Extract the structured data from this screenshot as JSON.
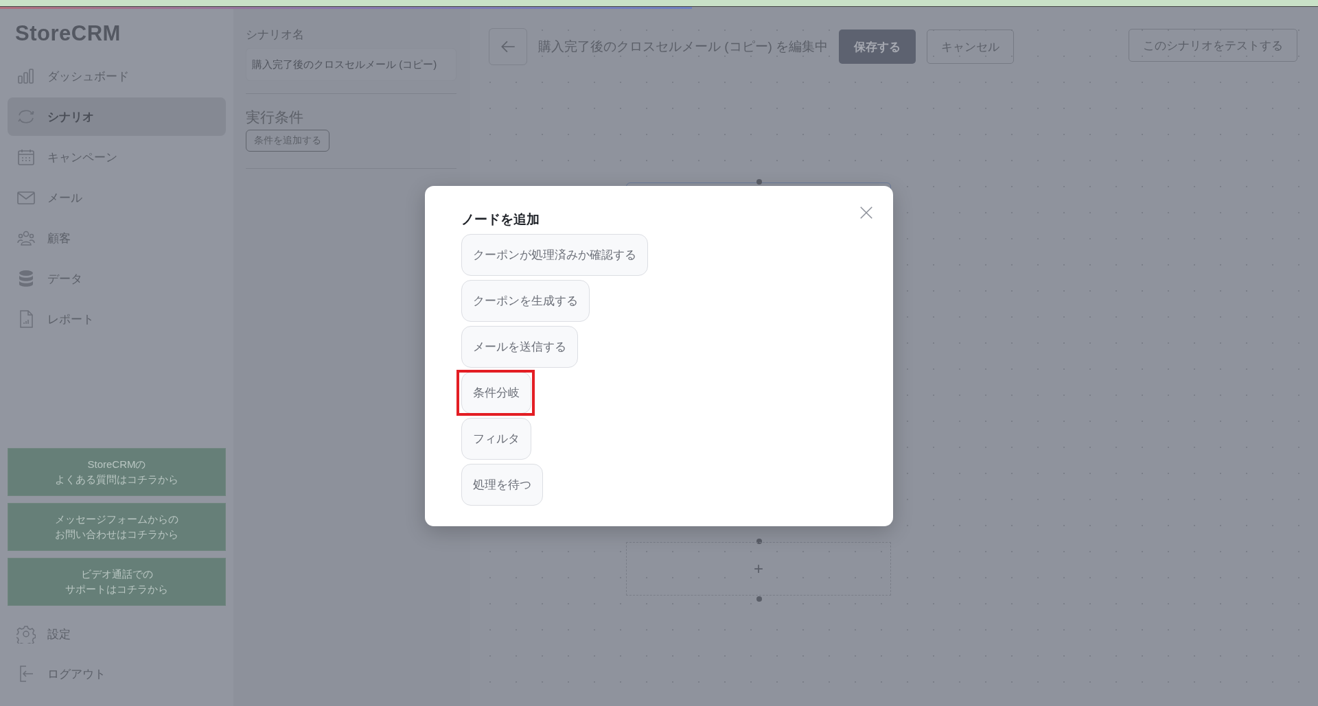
{
  "top_progress": {
    "level": 0.525
  },
  "sidebar": {
    "logo": "StoreCRM",
    "items": [
      {
        "label": "ダッシュボード",
        "selected": false
      },
      {
        "label": "シナリオ",
        "selected": true
      },
      {
        "label": "キャンペーン",
        "selected": false
      },
      {
        "label": "メール",
        "selected": false
      },
      {
        "label": "顧客",
        "selected": false
      },
      {
        "label": "データ",
        "selected": false
      },
      {
        "label": "レポート",
        "selected": false
      }
    ],
    "help_buttons": [
      {
        "lines": [
          "StoreCRMの",
          "よくある質問はコチラから"
        ]
      },
      {
        "lines": [
          "メッセージフォームからの",
          "お問い合わせはコチラから"
        ]
      },
      {
        "lines": [
          "ビデオ通話での",
          "サポートはコチラから"
        ]
      }
    ],
    "bottom_items": [
      {
        "label": "設定"
      },
      {
        "label": "ログアウト"
      }
    ]
  },
  "settings_panel": {
    "name_label": "シナリオ名",
    "name_value": "購入完了後のクロスセルメール (コピー)",
    "conditions_title": "実行条件",
    "add_condition": "条件を追加する"
  },
  "header": {
    "title": "購入完了後のクロスセルメール (コピー) を編集中",
    "save": "保存する",
    "cancel": "キャンセル",
    "test": "このシナリオをテストする"
  },
  "canvas": {
    "empty_node": "+"
  },
  "modal": {
    "title": "ノードを追加",
    "options": [
      {
        "label": "クーポンが処理済みか確認する",
        "highlighted": false
      },
      {
        "label": "クーポンを生成する",
        "highlighted": false
      },
      {
        "label": "メールを送信する",
        "highlighted": false
      },
      {
        "label": "条件分岐",
        "highlighted": true
      },
      {
        "label": "フィルタ",
        "highlighted": false
      },
      {
        "label": "処理を待つ",
        "highlighted": false
      }
    ]
  }
}
